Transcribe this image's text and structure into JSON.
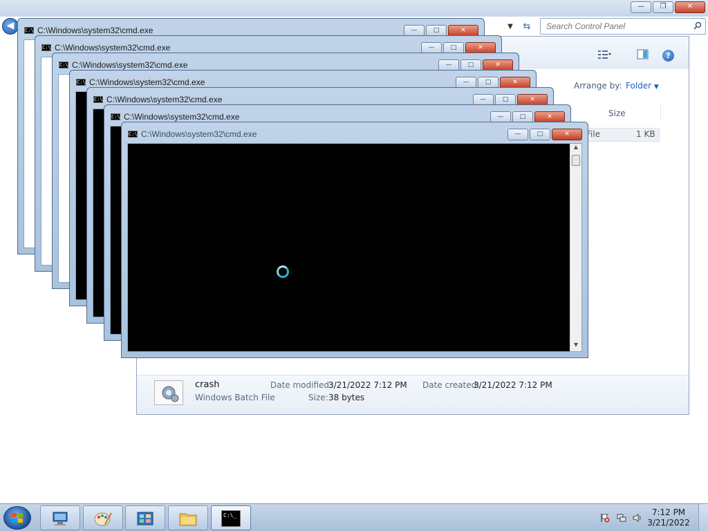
{
  "explorer": {
    "search_placeholder": "Search Control Panel",
    "arrange_by_label": "Arrange by:",
    "arrange_by_value": "Folder",
    "column_size": "Size",
    "file_type_fragment": "File",
    "file_size": "1 KB",
    "details": {
      "name": "crash",
      "type": "Windows Batch File",
      "date_modified_label": "Date modified:",
      "date_modified_value": "3/21/2022 7:12 PM",
      "date_created_label": "Date created:",
      "date_created_value": "3/21/2022 7:12 PM",
      "size_label": "Size:",
      "size_value": "38 bytes"
    }
  },
  "cmd_windows": [
    "C:\\Windows\\system32\\cmd.exe",
    "C:\\Windows\\system32\\cmd.exe",
    "C:\\Windows\\system32\\cmd.exe",
    "C:\\Windows\\system32\\cmd.exe",
    "C:\\Windows\\system32\\cmd.exe",
    "C:\\Windows\\system32\\cmd.exe",
    "C:\\Windows\\system32\\cmd.exe"
  ],
  "cmd_icon_text": "C:\\",
  "taskbar": {
    "buttons": [
      "remote-desktop-icon",
      "paint-icon",
      "control-panel-icon",
      "explorer-folder-icon",
      "cmd-icon"
    ],
    "cmd_button_text": "C:\\_",
    "clock_time": "7:12 PM",
    "clock_date": "3/21/2022"
  },
  "colors": {
    "titlebar_glass": "#b9cfe6",
    "console_bg": "#000000",
    "close_red": "#c53f25",
    "busy_cursor": "#2ab3d6"
  }
}
